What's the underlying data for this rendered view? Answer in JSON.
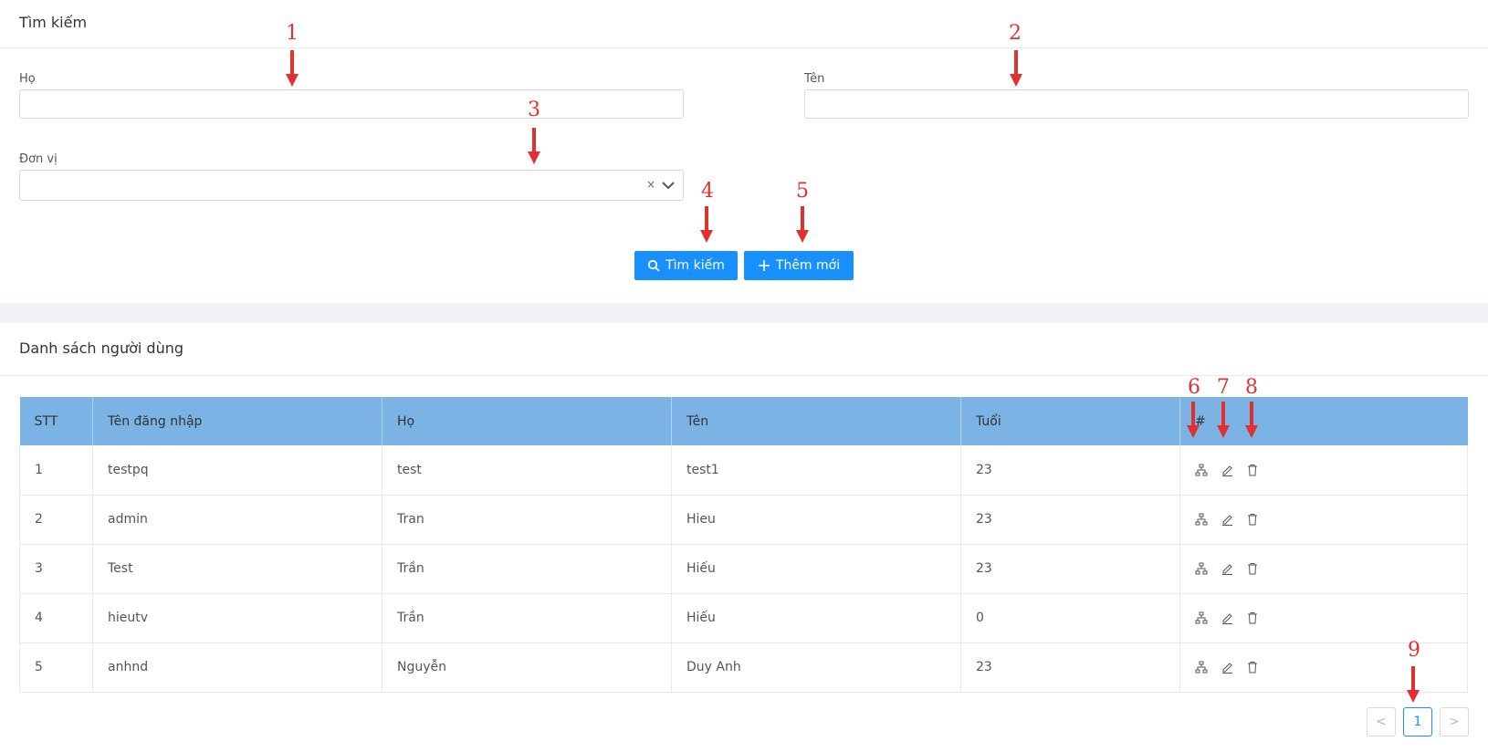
{
  "search_card": {
    "title": "Tìm kiếm"
  },
  "fields": {
    "ho_label": "Họ",
    "ho_value": "",
    "ten_label": "Tên",
    "ten_value": "",
    "don_vi_label": "Đơn vị",
    "don_vi_value": "",
    "clear_glyph": "×"
  },
  "buttons": {
    "search": "Tìm kiếm",
    "add": "Thêm mới"
  },
  "list_card": {
    "title": "Danh sách người dùng"
  },
  "table": {
    "headers": [
      "STT",
      "Tên đăng nhập",
      "Họ",
      "Tên",
      "Tuổi",
      "#"
    ],
    "rows": [
      [
        "1",
        "testpq",
        "test",
        "test1",
        "23"
      ],
      [
        "2",
        "admin",
        "Tran",
        "Hieu",
        "23"
      ],
      [
        "3",
        "Test",
        "Trần",
        "Hiếu",
        "23"
      ],
      [
        "4",
        "hieutv",
        "Trần",
        "Hiếu",
        "0"
      ],
      [
        "5",
        "anhnd",
        "Nguyễn",
        "Duy Anh",
        "23"
      ]
    ],
    "row_actions": [
      "org-tree-icon",
      "edit-icon",
      "delete-icon"
    ]
  },
  "pagination": {
    "prev": "<",
    "current": "1",
    "next": ">"
  },
  "annotations": [
    "1",
    "2",
    "3",
    "4",
    "5",
    "6",
    "7",
    "8",
    "9"
  ],
  "colors": {
    "primary": "#1890ff",
    "header_bg": "#7bb3e5",
    "marker": "#e03030"
  }
}
